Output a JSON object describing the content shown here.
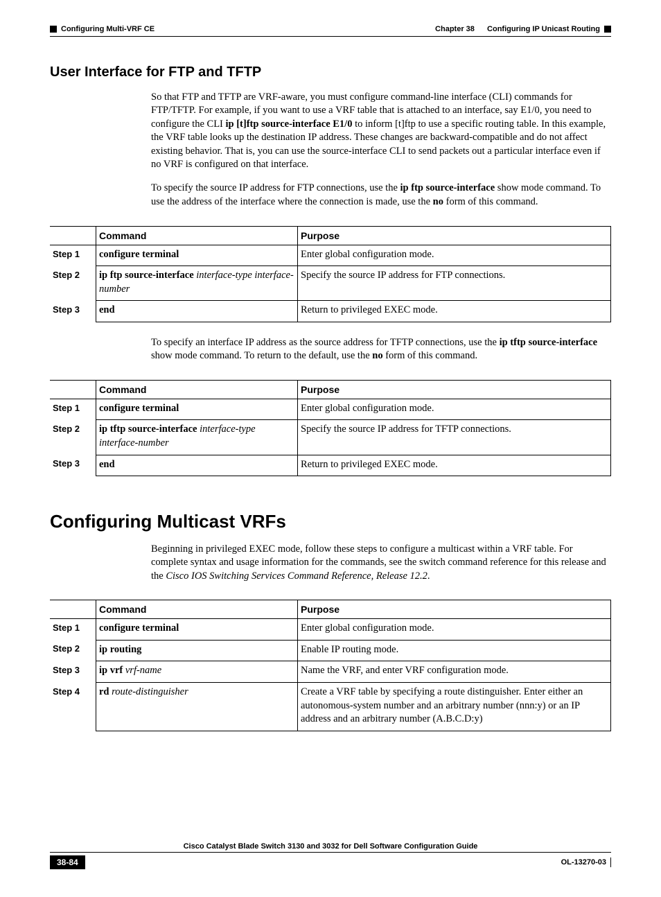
{
  "header": {
    "chapter_prefix": "Chapter 38",
    "chapter_title": "Configuring IP Unicast Routing",
    "section_title": "Configuring Multi-VRF CE"
  },
  "s1": {
    "heading": "User Interface for FTP and TFTP",
    "p1_a": "So that FTP and TFTP are VRF-aware, you must configure command-line interface (CLI) commands for FTP/TFTP. For example, if you want to use a VRF table that is attached to an interface, say E1/0, you need to configure the CLI ",
    "p1_b": "ip [t]ftp source-interface E1/0",
    "p1_c": " to inform [t]ftp to use a specific routing table. In this example, the VRF table looks up the destination IP address. These changes are backward-compatible and do not affect existing behavior. That is, you can use the source-interface CLI to send packets out a particular interface even if no VRF is configured on that interface.",
    "p2_a": "To specify the source IP address for FTP connections, use the ",
    "p2_b": "ip ftp source-interface",
    "p2_c": " show mode command. To use the address of the interface where the connection is made, use the ",
    "p2_d": "no",
    "p2_e": " form of this command."
  },
  "t": {
    "h_cmd": "Command",
    "h_purpose": "Purpose",
    "step1": "Step 1",
    "step2": "Step 2",
    "step3": "Step 3",
    "step4": "Step 4"
  },
  "t1": {
    "r1_cmd": "configure terminal",
    "r1_pur": "Enter global configuration mode.",
    "r2_cmd_b": "ip ftp source-interface",
    "r2_cmd_i": " interface-type interface-number",
    "r2_pur": "Specify the source IP address for FTP connections.",
    "r3_cmd": "end",
    "r3_pur": "Return to privileged EXEC mode."
  },
  "s2": {
    "p_a": "To specify an interface IP address as the source address for TFTP connections, use the ",
    "p_b": "ip tftp source-interface",
    "p_c": " show mode command. To return to the default, use the ",
    "p_d": "no",
    "p_e": " form of this command."
  },
  "t2": {
    "r1_cmd": "configure terminal",
    "r1_pur": "Enter global configuration mode.",
    "r2_cmd_b": "ip tftp source-interface",
    "r2_cmd_i": " interface-type interface-number",
    "r2_pur": "Specify the source IP address for TFTP connections.",
    "r3_cmd": "end",
    "r3_pur": "Return to privileged EXEC mode."
  },
  "s3": {
    "heading": "Configuring Multicast VRFs",
    "p_a": "Beginning in privileged EXEC mode, follow these steps to configure a multicast within a VRF table. For complete syntax and usage information for the commands, see the switch command reference for this release and the ",
    "p_b": "Cisco IOS Switching Services Command Reference, Release 12.2",
    "p_c": "."
  },
  "t3": {
    "r1_cmd": "configure terminal",
    "r1_pur": "Enter global configuration mode.",
    "r2_cmd": "ip routing",
    "r2_pur": "Enable IP routing mode.",
    "r3_cmd_b": "ip vrf",
    "r3_cmd_i": " vrf-name",
    "r3_pur": "Name the VRF, and enter VRF configuration mode.",
    "r4_cmd_b": "rd",
    "r4_cmd_i": " route-distinguisher",
    "r4_pur": "Create a VRF table by specifying a route distinguisher. Enter either an autonomous-system number and an arbitrary number (nnn:y) or an IP address and an arbitrary number (A.B.C.D:y)"
  },
  "footer": {
    "title": "Cisco Catalyst Blade Switch 3130 and 3032 for Dell Software Configuration Guide",
    "page": "38-84",
    "docid": "OL-13270-03"
  }
}
